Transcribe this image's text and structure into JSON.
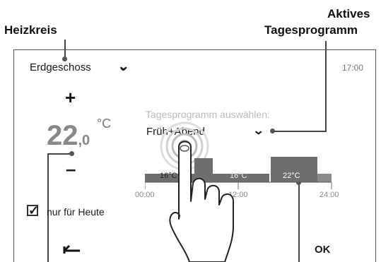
{
  "callouts": {
    "heizkreis": "Heizkreis",
    "aktives_line1": "Aktives",
    "aktives_line2": "Tagesprogramm"
  },
  "header": {
    "circuit_select": "Erdgeschoss",
    "clock": "17:00"
  },
  "temperature": {
    "plus": "+",
    "minus": "–",
    "integer": "22",
    "decimal": ",0",
    "unit": "°C"
  },
  "program": {
    "hint": "Tagesprogramm auswählen:",
    "selected": "Früh+Abend"
  },
  "timeline": {
    "segments": [
      "16°C",
      "16°C",
      "22°C"
    ],
    "axis": [
      "00:00",
      "12:00",
      "24:00"
    ]
  },
  "today_only": {
    "label": "nur für Heute",
    "checked": true
  },
  "footer": {
    "back_icon": "back-arrow-icon",
    "ok_label": "OK"
  },
  "colors": {
    "bar_dark": "#6e6e6e",
    "bar_mid": "#8a8a8a"
  }
}
